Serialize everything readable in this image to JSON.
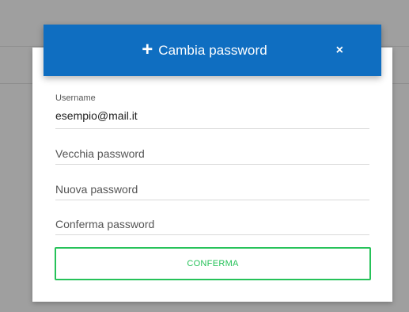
{
  "dialog": {
    "title": "Cambia password",
    "plus_icon": "+",
    "close_icon": "×"
  },
  "form": {
    "username_label": "Username",
    "username_value": "esempio@mail.it",
    "old_password_placeholder": "Vecchia password",
    "new_password_placeholder": "Nuova password",
    "confirm_password_placeholder": "Conferma password",
    "confirm_button_label": "CONFERMA"
  },
  "colors": {
    "header": "#0f6ec1",
    "confirm": "#26c259",
    "backdrop": "#9f9f9f"
  }
}
